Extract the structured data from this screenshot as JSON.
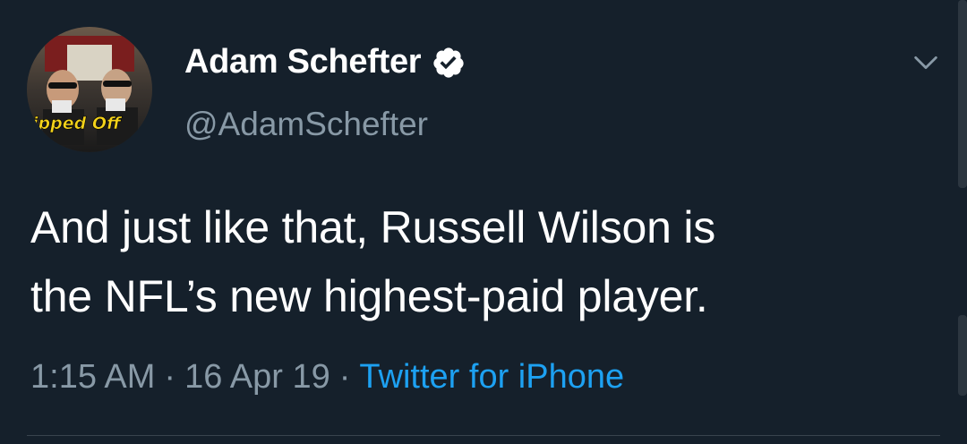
{
  "tweet": {
    "display_name": "Adam Schefter",
    "handle": "@AdamSchefter",
    "text_line_1": "And just like that, Russell Wilson is",
    "text_line_2": "the NFL’s new highest-paid player.",
    "time": "1:15 AM",
    "separator": "·",
    "date": "16 Apr 19",
    "source": "Twitter for iPhone",
    "avatar_caption": "Tipped Off"
  },
  "icons": {
    "verified": "verified-badge-icon",
    "menu": "chevron-down-icon"
  },
  "colors": {
    "background": "#15202b",
    "secondary_text": "#8899a6",
    "link": "#1da1f2",
    "divider": "#38444d"
  }
}
